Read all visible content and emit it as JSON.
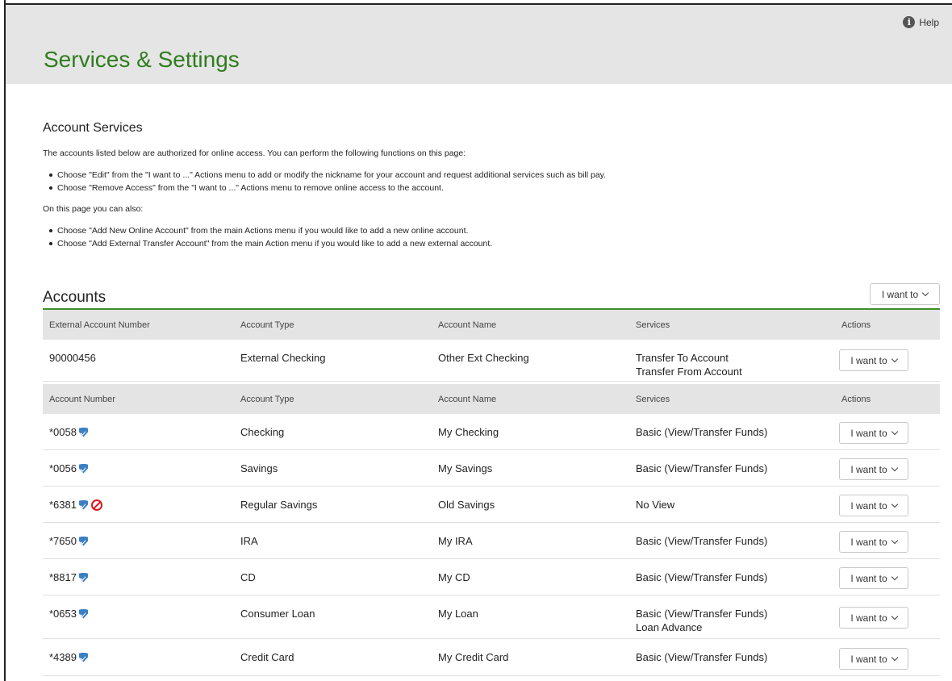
{
  "header": {
    "help_label": "Help",
    "help_icon": "info-icon",
    "title": "Services & Settings"
  },
  "intro": {
    "section_title": "Account Services",
    "description": "The accounts listed below are authorized for online access. You can perform the following functions on this page:",
    "bullets": [
      "Choose \"Edit\" from the \"I want to ...\" Actions menu to add or modify the nickname for your account and request additional services such as bill pay.",
      "Choose \"Remove Access\" from the \"I want to ...\" Actions menu to remove online access to the account."
    ],
    "also_text": "On this page you can also:",
    "also_bullets": [
      "Choose \"Add New Online Account\" from the main Actions menu if you would like to add a new online account.",
      "Choose \"Add External Transfer Account\" from the main Action menu if you would like to add a new external account."
    ]
  },
  "accounts": {
    "title": "Accounts",
    "action_label": "I want to"
  },
  "external_table": {
    "headers": [
      "External Account Number",
      "Account Type",
      "Account Name",
      "Services",
      "Actions"
    ],
    "rows": [
      {
        "number": "90000456",
        "type": "External Checking",
        "name": "Other Ext Checking",
        "services": [
          "Transfer To Account",
          "Transfer From Account"
        ],
        "action": "I want to"
      }
    ]
  },
  "account_table": {
    "headers": [
      "Account Number",
      "Account Type",
      "Account Name",
      "Services",
      "Actions"
    ],
    "rows": [
      {
        "number": "*0058",
        "type": "Checking",
        "name": "My Checking",
        "services": [
          "Basic (View/Transfer Funds)"
        ],
        "action": "I want to",
        "icons": [
          "shield-icon"
        ]
      },
      {
        "number": "*0056",
        "type": "Savings",
        "name": "My Savings",
        "services": [
          "Basic (View/Transfer Funds)"
        ],
        "action": "I want to",
        "icons": [
          "shield-icon"
        ]
      },
      {
        "number": "*6381",
        "type": "Regular Savings",
        "name": "Old Savings",
        "services": [
          "No View"
        ],
        "action": "I want to",
        "icons": [
          "shield-icon",
          "no-view-icon"
        ]
      },
      {
        "number": "*7650",
        "type": "IRA",
        "name": "My IRA",
        "services": [
          "Basic (View/Transfer Funds)"
        ],
        "action": "I want to",
        "icons": [
          "shield-icon"
        ]
      },
      {
        "number": "*8817",
        "type": "CD",
        "name": "My CD",
        "services": [
          "Basic (View/Transfer Funds)"
        ],
        "action": "I want to",
        "icons": [
          "shield-icon"
        ]
      },
      {
        "number": "*0653",
        "type": "Consumer Loan",
        "name": "My Loan",
        "services": [
          "Basic (View/Transfer Funds)",
          "Loan Advance"
        ],
        "action": "I want to",
        "icons": [
          "shield-icon"
        ]
      },
      {
        "number": "*4389",
        "type": "Credit Card",
        "name": "My Credit Card",
        "services": [
          "Basic (View/Transfer Funds)"
        ],
        "action": "I want to",
        "icons": [
          "shield-icon"
        ]
      }
    ]
  },
  "colors": {
    "brand_green": "#2f7d1e",
    "accent_line": "#3e8e2a",
    "header_bg": "#e5e5e5",
    "shield_blue": "#3a7fc4",
    "no_view_red": "#e0161b"
  }
}
